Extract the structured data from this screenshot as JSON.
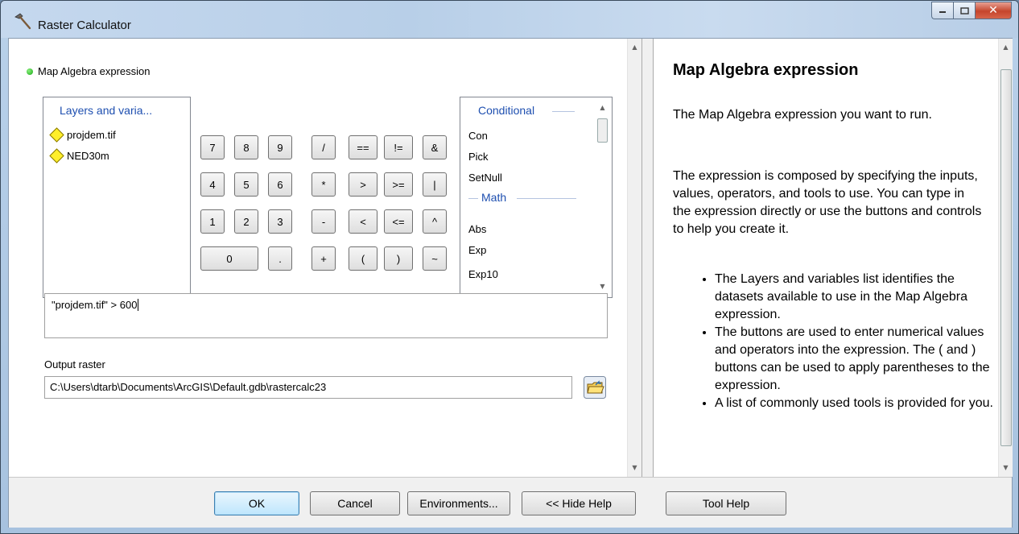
{
  "window": {
    "title": "Raster Calculator",
    "icon": "hammer-icon",
    "controls": [
      "minimize-icon",
      "maximize-icon",
      "close-icon"
    ]
  },
  "parameter": {
    "label": "Map Algebra expression"
  },
  "layers": {
    "heading": "Layers and varia...",
    "items": [
      "projdem.tif",
      "NED30m"
    ]
  },
  "keypad": {
    "row1": [
      "7",
      "8",
      "9",
      "/",
      "==",
      "!=",
      "&"
    ],
    "row2": [
      "4",
      "5",
      "6",
      "*",
      ">",
      ">=",
      "|"
    ],
    "row3": [
      "1",
      "2",
      "3",
      "-",
      "<",
      "<=",
      "^"
    ],
    "row4": [
      "0",
      ".",
      "+",
      "(",
      ")",
      "~"
    ]
  },
  "tools": {
    "group1": "Conditional",
    "group1_items": [
      "Con",
      "Pick",
      "SetNull"
    ],
    "group2": "Math",
    "group2_items": [
      "Abs",
      "Exp",
      "Exp10"
    ]
  },
  "expression": {
    "value": "\"projdem.tif\" > 600"
  },
  "output": {
    "label": "Output raster",
    "value": "C:\\Users\\dtarb\\Documents\\ArcGIS\\Default.gdb\\rastercalc23"
  },
  "help": {
    "title": "Map Algebra expression",
    "p1": "The Map Algebra expression you want to run.",
    "p2": "The expression is composed by specifying the inputs, values, operators, and tools to use. You can type in the expression directly or use the buttons and controls to help you create it.",
    "bullets": [
      "The Layers and variables list identifies the datasets available to use in the Map Algebra expression.",
      "The buttons are used to enter numerical values and operators into the expression. The ( and ) buttons can be used to apply parentheses to the expression.",
      "A list of commonly used tools is provided for you."
    ]
  },
  "buttons": {
    "ok": "OK",
    "cancel": "Cancel",
    "environments": "Environments...",
    "hide_help": "<< Hide Help",
    "tool_help": "Tool Help"
  }
}
